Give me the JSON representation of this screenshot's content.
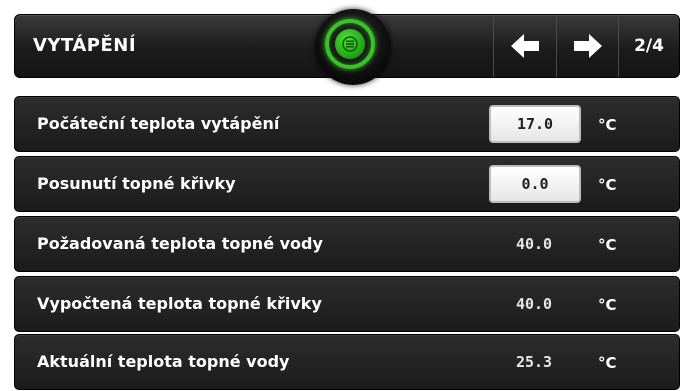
{
  "header": {
    "title": "VYTÁPĚNÍ",
    "menu_icon": "menu-icon",
    "prev_icon": "arrow-left-icon",
    "next_icon": "arrow-right-icon",
    "page_indicator": "2/4",
    "accent_color": "#39c22a"
  },
  "rows": [
    {
      "label": "Počáteční teplota vytápění",
      "value": "17.0",
      "unit": "°C",
      "editable": true
    },
    {
      "label": "Posunutí topné křivky",
      "value": "0.0",
      "unit": "°C",
      "editable": true
    },
    {
      "label": "Požadovaná teplota topné vody",
      "value": "40.0",
      "unit": "°C",
      "editable": false
    },
    {
      "label": "Vypočtená teplota topné křivky",
      "value": "40.0",
      "unit": "°C",
      "editable": false
    },
    {
      "label": "Aktuální teplota topné vody",
      "value": "25.3",
      "unit": "°C",
      "editable": false
    }
  ]
}
